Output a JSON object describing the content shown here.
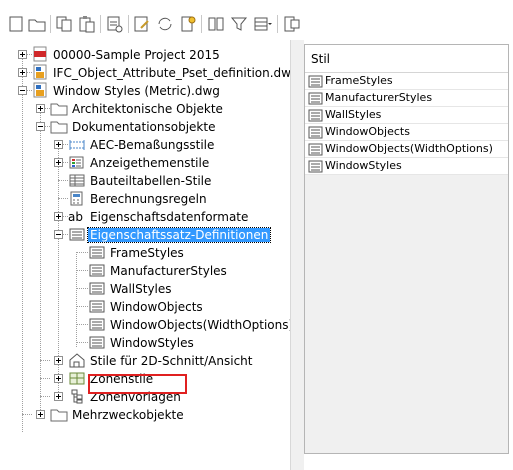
{
  "toolbar": {
    "buttons": [
      {
        "name": "new-icon"
      },
      {
        "name": "open-folder-icon"
      },
      {
        "name": "copy-icon"
      },
      {
        "name": "paste-icon"
      },
      {
        "name": "purge-icon"
      },
      {
        "name": "edit-style-icon"
      },
      {
        "name": "synchronize-icon"
      },
      {
        "name": "update-icon"
      },
      {
        "name": "list-view-icon"
      },
      {
        "name": "filter-icon"
      },
      {
        "name": "view-options-icon"
      },
      {
        "name": "inline-edit-icon"
      }
    ]
  },
  "tree": {
    "items": [
      {
        "label": "00000-Sample Project 2015",
        "icon": "project-file-icon"
      },
      {
        "label": "IFC_Object_Attribute_Pset_definition.dwg",
        "icon": "drawing-icon"
      },
      {
        "label": "Window Styles (Metric).dwg",
        "icon": "drawing-icon"
      },
      {
        "label": "Architektonische Objekte",
        "icon": "folder-icon"
      },
      {
        "label": "Dokumentationsobjekte",
        "icon": "folder-icon"
      },
      {
        "label": "AEC-Bemaßungsstile",
        "icon": "dimension-icon"
      },
      {
        "label": "Anzeigethemenstile",
        "icon": "display-theme-icon"
      },
      {
        "label": "Bauteiltabellen-Stile",
        "icon": "schedule-table-icon"
      },
      {
        "label": "Berechnungsregeln",
        "icon": "calculation-icon"
      },
      {
        "label": "Eigenschaftsdatenformate",
        "icon": "property-format-icon"
      },
      {
        "label": "Eigenschaftssatz-Definitionen",
        "icon": "property-set-icon"
      },
      {
        "label": "FrameStyles",
        "icon": "property-set-icon"
      },
      {
        "label": "ManufacturerStyles",
        "icon": "property-set-icon"
      },
      {
        "label": "WallStyles",
        "icon": "property-set-icon"
      },
      {
        "label": "WindowObjects",
        "icon": "property-set-icon"
      },
      {
        "label": "WindowObjects(WidthOptions)",
        "icon": "property-set-icon"
      },
      {
        "label": "WindowStyles",
        "icon": "property-set-icon"
      },
      {
        "label": "Stile für 2D-Schnitt/Ansicht",
        "icon": "section-style-icon"
      },
      {
        "label": "Zonenstile",
        "icon": "zone-icon"
      },
      {
        "label": "Zonenvorlagen",
        "icon": "zone-template-icon"
      },
      {
        "label": "Mehrzweckobjekte",
        "icon": "folder-icon"
      }
    ]
  },
  "rightpane": {
    "header": "Stil",
    "rows": [
      "FrameStyles",
      "ManufacturerStyles",
      "WallStyles",
      "WindowObjects",
      "WindowObjects(WidthOptions)",
      "WindowStyles"
    ]
  },
  "colors": {
    "selection": "#3399ff",
    "highlight_box": "#e02020"
  }
}
